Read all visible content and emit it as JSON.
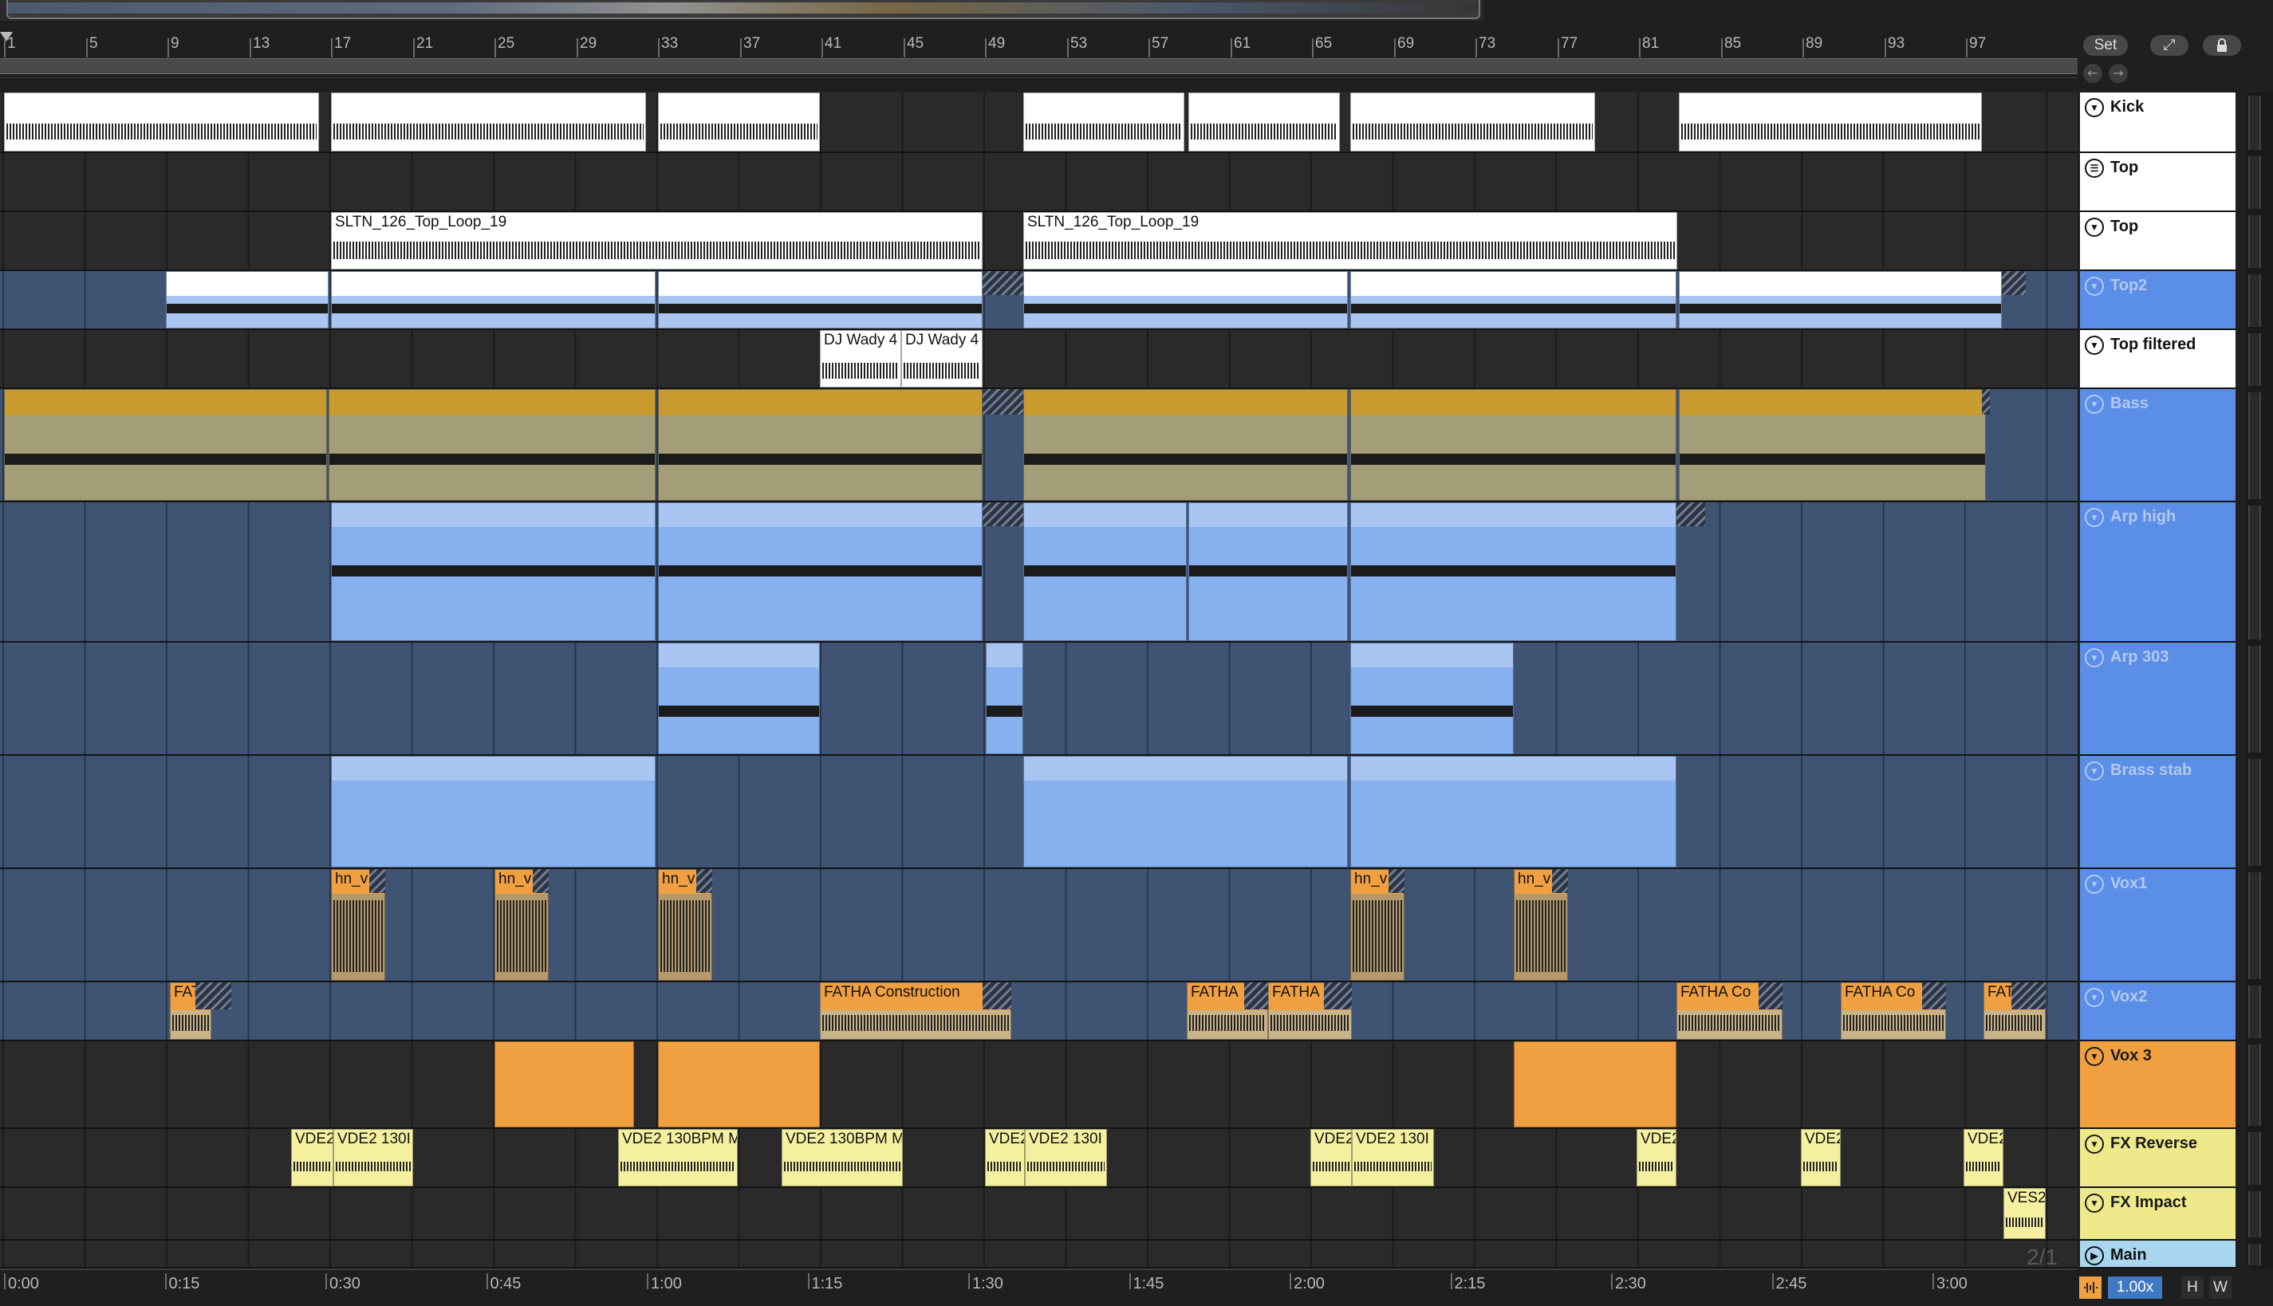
{
  "ruler": {
    "bars": [
      "1",
      "5",
      "9",
      "13",
      "17",
      "21",
      "25",
      "29",
      "33",
      "37",
      "41",
      "45",
      "49",
      "53",
      "57",
      "61",
      "65",
      "69",
      "73",
      "77",
      "81",
      "85",
      "89",
      "93",
      "97"
    ],
    "set_label": "Set",
    "expand_icon": "⤢",
    "lock_icon": "lock-icon",
    "back_icon": "←",
    "fwd_icon": "→"
  },
  "time_labels": [
    "0:00",
    "0:15",
    "0:30",
    "0:45",
    "1:00",
    "1:15",
    "1:30",
    "1:45",
    "2:00",
    "2:15",
    "2:30",
    "2:45",
    "3:00"
  ],
  "tracks": [
    {
      "name": "Kick",
      "fold": "▼",
      "color": "#ffffff",
      "text": "#111111",
      "muted": false
    },
    {
      "name": "Top",
      "fold": "☰",
      "color": "#ffffff",
      "text": "#111111",
      "muted": false
    },
    {
      "name": "Top",
      "fold": "▼",
      "color": "#ffffff",
      "text": "#111111",
      "muted": false
    },
    {
      "name": "Top2",
      "fold": "▼",
      "color": "#5b8ee6",
      "text": "#b4c8ee",
      "muted": true
    },
    {
      "name": "Top filtered",
      "fold": "▼",
      "color": "#ffffff",
      "text": "#111111",
      "muted": false
    },
    {
      "name": "Bass",
      "fold": "▼",
      "color": "#5b8ee6",
      "text": "#b4c8ee",
      "muted": true
    },
    {
      "name": "Arp high",
      "fold": "▼",
      "color": "#5b8ee6",
      "text": "#b4c8ee",
      "muted": true
    },
    {
      "name": "Arp 303",
      "fold": "▼",
      "color": "#5b8ee6",
      "text": "#b4c8ee",
      "muted": true
    },
    {
      "name": "Brass stab",
      "fold": "▼",
      "color": "#5b8ee6",
      "text": "#b4c8ee",
      "muted": true
    },
    {
      "name": "Vox1",
      "fold": "▼",
      "color": "#5b8ee6",
      "text": "#b4c8ee",
      "muted": true
    },
    {
      "name": "Vox2",
      "fold": "▼",
      "color": "#5b8ee6",
      "text": "#b4c8ee",
      "muted": true
    },
    {
      "name": "Vox 3",
      "fold": "▼",
      "color": "#f0a040",
      "text": "#1a1a1a",
      "muted": false
    },
    {
      "name": "FX Reverse",
      "fold": "▼",
      "color": "#eee98a",
      "text": "#1a1a1a",
      "muted": false
    },
    {
      "name": "FX Impact",
      "fold": "▼",
      "color": "#eee98a",
      "text": "#1a1a1a",
      "muted": false
    },
    {
      "name": "Main",
      "fold": "▶",
      "color": "#a9d6ee",
      "text": "#111111",
      "muted": false
    }
  ],
  "clip_names": {
    "top_loop": "SLTN_126_Top_Loop_19",
    "dj_wady_a": "DJ Wady 4",
    "dj_wady_b": "DJ Wady 4",
    "hn": "hn_v",
    "fat_short": "FAT",
    "fatha_construction": "FATHA Construction",
    "fatha": "FATHA",
    "fatha_co": "FATHA Co",
    "vde2_short": "VDE2",
    "vde2_130": "VDE2 130I",
    "vde2_130bpm": "VDE2 130BPM M",
    "ves2": "VES2"
  },
  "footer": {
    "zoom": "1.00x",
    "h_label": "H",
    "w_label": "W",
    "grid_label": "2/1"
  }
}
